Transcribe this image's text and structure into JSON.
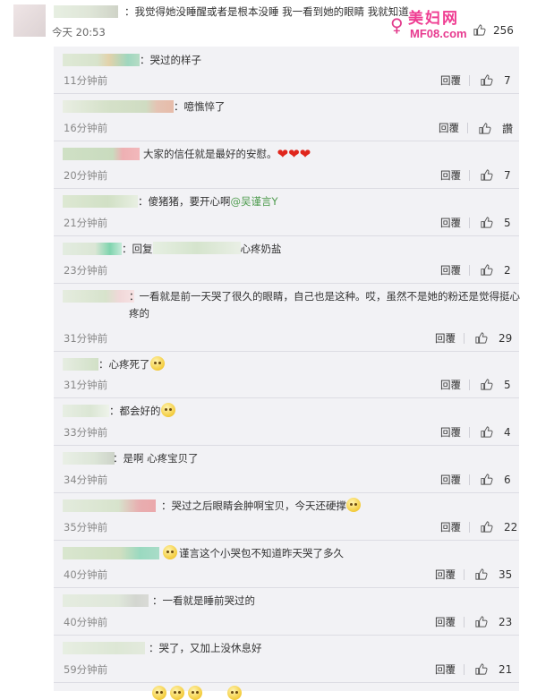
{
  "post": {
    "text": "：我觉得她没睡醒或者是根本没睡 我一看到她的眼睛 我就知道",
    "time": "今天 20:53",
    "likes": "256"
  },
  "watermark": {
    "cn": "美妇网",
    "en": "MF08.com"
  },
  "reply_label": "回覆",
  "comments": [
    {
      "text": "：哭过的样子",
      "time": "11分钟前",
      "likes": "7"
    },
    {
      "text": "：噫憔悴了",
      "time": "16分钟前",
      "likes": "讚"
    },
    {
      "text": "大家的信任就是最好的安慰。",
      "time": "20分钟前",
      "likes": "7"
    },
    {
      "text": "：傻猪猪，要开心啊",
      "mention": "@吴谨言Y",
      "time": "21分钟前",
      "likes": "5"
    },
    {
      "text": "：回复",
      "text2": "心疼奶盐",
      "time": "23分钟前",
      "likes": "2"
    },
    {
      "text": "：一看就是前一天哭了很久的眼睛，自己也是这种。哎，虽然不是她的粉还是觉得挺心疼的",
      "time": "31分钟前",
      "likes": "29"
    },
    {
      "text": "：心疼死了",
      "time": "31分钟前",
      "likes": "5"
    },
    {
      "text": "：都会好的",
      "time": "33分钟前",
      "likes": "4"
    },
    {
      "text": "：是啊 心疼宝贝了",
      "time": "34分钟前",
      "likes": "6"
    },
    {
      "text": "：哭过之后眼睛会肿啊宝贝，今天还硬撑",
      "time": "35分钟前",
      "likes": "22"
    },
    {
      "text": "谨言这个小哭包不知道昨天哭了多久",
      "time": "40分钟前",
      "likes": "35"
    },
    {
      "text": "：一看就是睡前哭过的",
      "time": "40分钟前",
      "likes": "23"
    },
    {
      "text": "：哭了，又加上没休息好",
      "time": "59分钟前",
      "likes": "21"
    }
  ],
  "icons": {
    "like": "thumbs-up-icon",
    "emoji": "smiley-icon",
    "heart": "heart-icon"
  },
  "colors": {
    "mention": "#4c9a4c",
    "panel_bg": "#f2f2f5",
    "watermark": "#ef3d92"
  }
}
